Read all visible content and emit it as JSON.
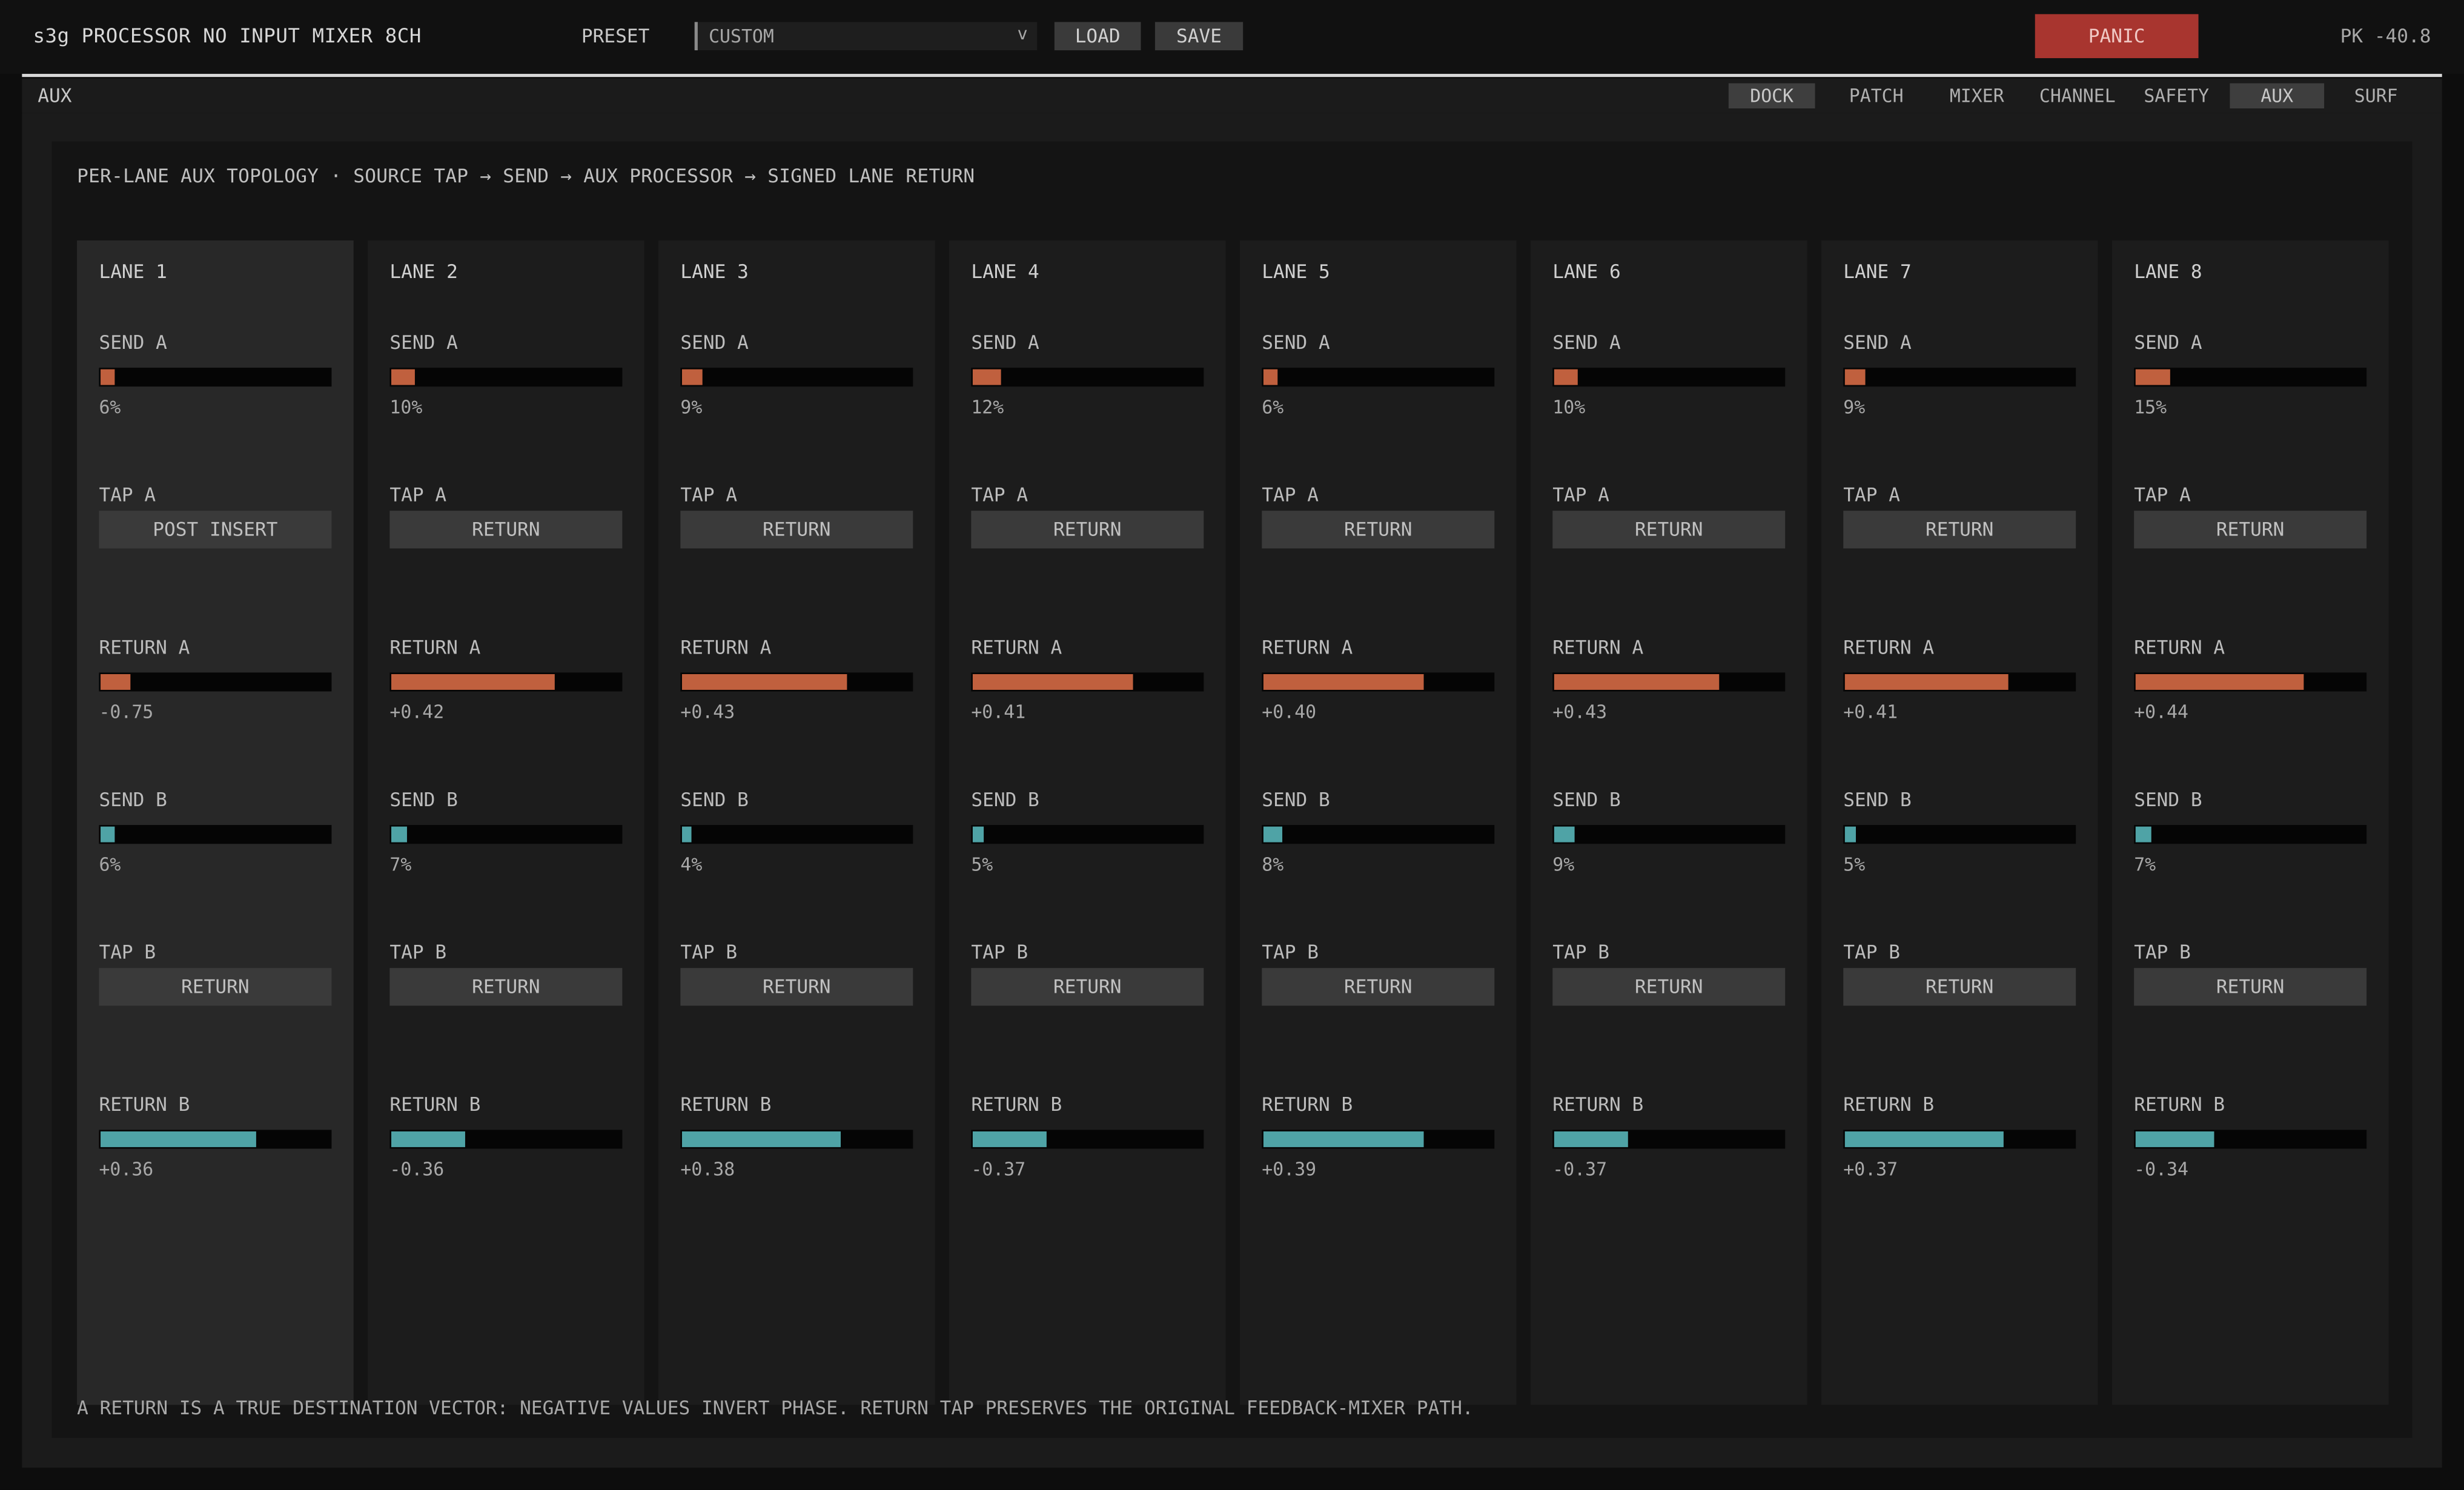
{
  "header": {
    "app_title": "s3g PROCESSOR NO INPUT MIXER 8CH",
    "preset_label": "PRESET",
    "preset_value": "CUSTOM",
    "preset_chevron": "v",
    "load_label": "LOAD",
    "save_label": "SAVE",
    "panic_label": "PANIC",
    "peak_readout": "PK -40.8"
  },
  "nav": {
    "section": "AUX",
    "tabs": [
      {
        "label": "DOCK",
        "active": true
      },
      {
        "label": "PATCH",
        "active": false
      },
      {
        "label": "MIXER",
        "active": false
      },
      {
        "label": "CHANNEL",
        "active": false
      },
      {
        "label": "SAFETY",
        "active": false
      },
      {
        "label": "AUX",
        "active": true
      },
      {
        "label": "SURF",
        "active": false
      }
    ]
  },
  "panel": {
    "title": "PER-LANE AUX TOPOLOGY · SOURCE TAP → SEND → AUX PROCESSOR → SIGNED LANE RETURN",
    "footnote": "A RETURN IS A TRUE DESTINATION VECTOR: NEGATIVE VALUES INVERT PHASE. RETURN TAP PRESERVES THE ORIGINAL FEEDBACK-MIXER PATH."
  },
  "labels": {
    "send_a": "SEND A",
    "tap_a": "TAP A",
    "return_a": "RETURN A",
    "send_b": "SEND B",
    "tap_b": "TAP B",
    "return_b": "RETURN B"
  },
  "colors": {
    "aux_a": "#c0603e",
    "aux_b": "#4fa3a6",
    "panic": "#a8352f"
  },
  "lanes": [
    {
      "name": "LANE 1",
      "selected": true,
      "send_a": "6%",
      "tap_a": "POST INSERT",
      "return_a": "-0.75",
      "send_b": "6%",
      "tap_b": "RETURN",
      "return_b": "+0.36",
      "return_a_level": 0.13,
      "return_b_level": 0.68
    },
    {
      "name": "LANE 2",
      "selected": false,
      "send_a": "10%",
      "tap_a": "RETURN",
      "return_a": "+0.42",
      "send_b": "7%",
      "tap_b": "RETURN",
      "return_b": "-0.36",
      "return_a_level": 0.71,
      "return_b_level": 0.32
    },
    {
      "name": "LANE 3",
      "selected": false,
      "send_a": "9%",
      "tap_a": "RETURN",
      "return_a": "+0.43",
      "send_b": "4%",
      "tap_b": "RETURN",
      "return_b": "+0.38",
      "return_a_level": 0.72,
      "return_b_level": 0.69
    },
    {
      "name": "LANE 4",
      "selected": false,
      "send_a": "12%",
      "tap_a": "RETURN",
      "return_a": "+0.41",
      "send_b": "5%",
      "tap_b": "RETURN",
      "return_b": "-0.37",
      "return_a_level": 0.7,
      "return_b_level": 0.32
    },
    {
      "name": "LANE 5",
      "selected": false,
      "send_a": "6%",
      "tap_a": "RETURN",
      "return_a": "+0.40",
      "send_b": "8%",
      "tap_b": "RETURN",
      "return_b": "+0.39",
      "return_a_level": 0.7,
      "return_b_level": 0.7
    },
    {
      "name": "LANE 6",
      "selected": false,
      "send_a": "10%",
      "tap_a": "RETURN",
      "return_a": "+0.43",
      "send_b": "9%",
      "tap_b": "RETURN",
      "return_b": "-0.37",
      "return_a_level": 0.72,
      "return_b_level": 0.32
    },
    {
      "name": "LANE 7",
      "selected": false,
      "send_a": "9%",
      "tap_a": "RETURN",
      "return_a": "+0.41",
      "send_b": "5%",
      "tap_b": "RETURN",
      "return_b": "+0.37",
      "return_a_level": 0.71,
      "return_b_level": 0.69
    },
    {
      "name": "LANE 8",
      "selected": false,
      "send_a": "15%",
      "tap_a": "RETURN",
      "return_a": "+0.44",
      "send_b": "7%",
      "tap_b": "RETURN",
      "return_b": "-0.34",
      "return_a_level": 0.73,
      "return_b_level": 0.34
    }
  ]
}
